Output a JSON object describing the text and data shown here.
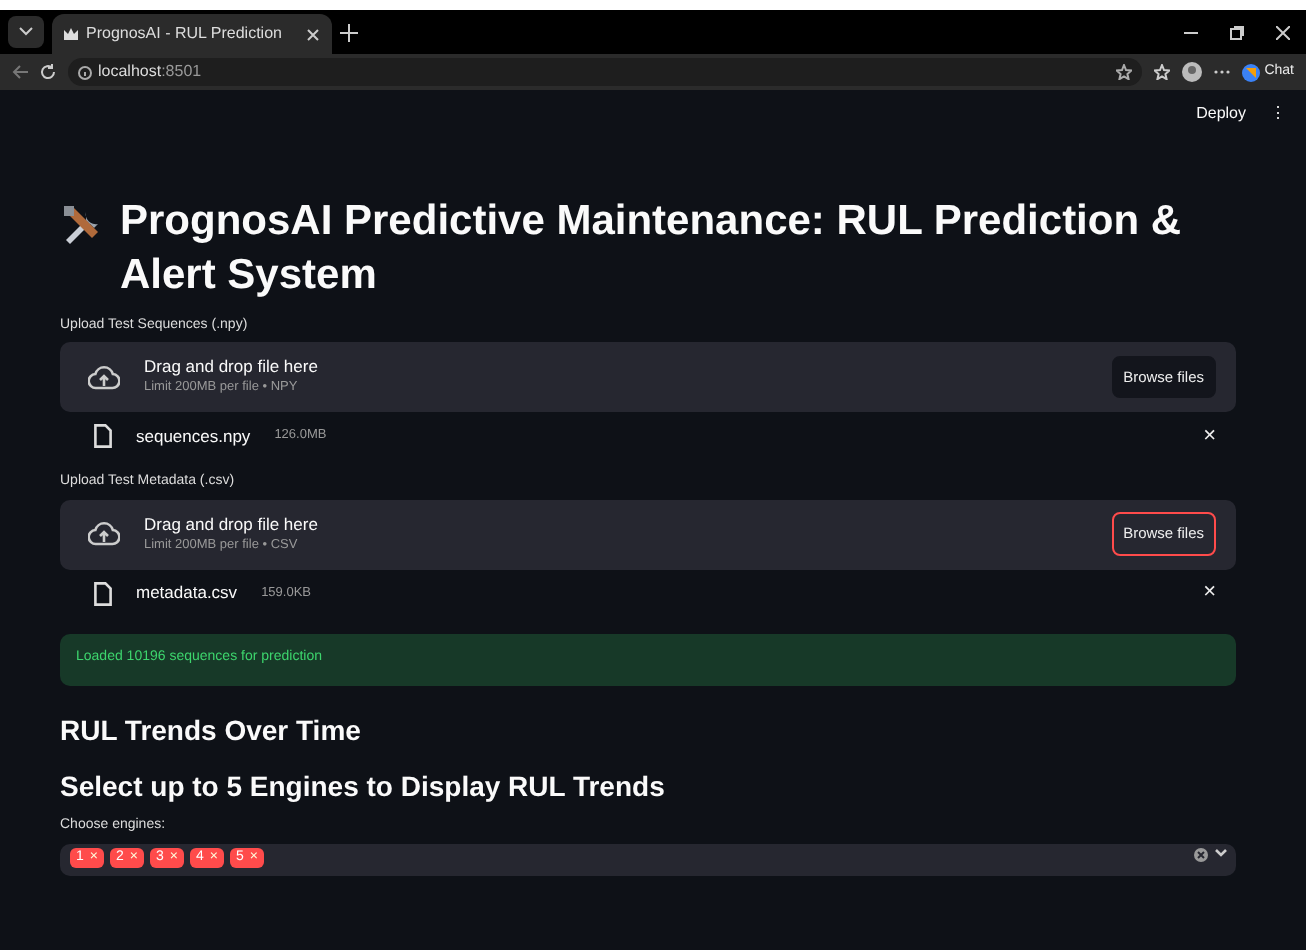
{
  "browser": {
    "tab_title": "PrognosAI - RUL Prediction",
    "address_host": "localhost",
    "address_port": ":8501",
    "chat_label": "Chat"
  },
  "toolbar": {
    "deploy": "Deploy",
    "menu": "⋮"
  },
  "title": "PrognosAI Predictive Maintenance: RUL Prediction & Alert System",
  "uploaders": [
    {
      "label": "Upload Test Sequences (.npy)",
      "drop_text": "Drag and drop file here",
      "limit": "Limit 200MB per file • NPY",
      "button": "Browse files",
      "focused": false,
      "file_name": "sequences.npy",
      "file_size": "126.0MB",
      "remove": "×"
    },
    {
      "label": "Upload Test Metadata (.csv)",
      "drop_text": "Drag and drop file here",
      "limit": "Limit 200MB per file • CSV",
      "button": "Browse files",
      "focused": true,
      "file_name": "metadata.csv",
      "file_size": "159.0KB",
      "remove": "×"
    }
  ],
  "success": "Loaded 10196 sequences for prediction",
  "heading_trends": "RUL Trends Over Time",
  "heading_select": "Select up to 5 Engines to Display RUL Trends",
  "multiselect": {
    "label": "Choose engines:",
    "chips": [
      {
        "label": "1",
        "remove": "×"
      },
      {
        "label": "2",
        "remove": "×"
      },
      {
        "label": "3",
        "remove": "×"
      },
      {
        "label": "4",
        "remove": "×"
      },
      {
        "label": "5",
        "remove": "×"
      }
    ]
  }
}
